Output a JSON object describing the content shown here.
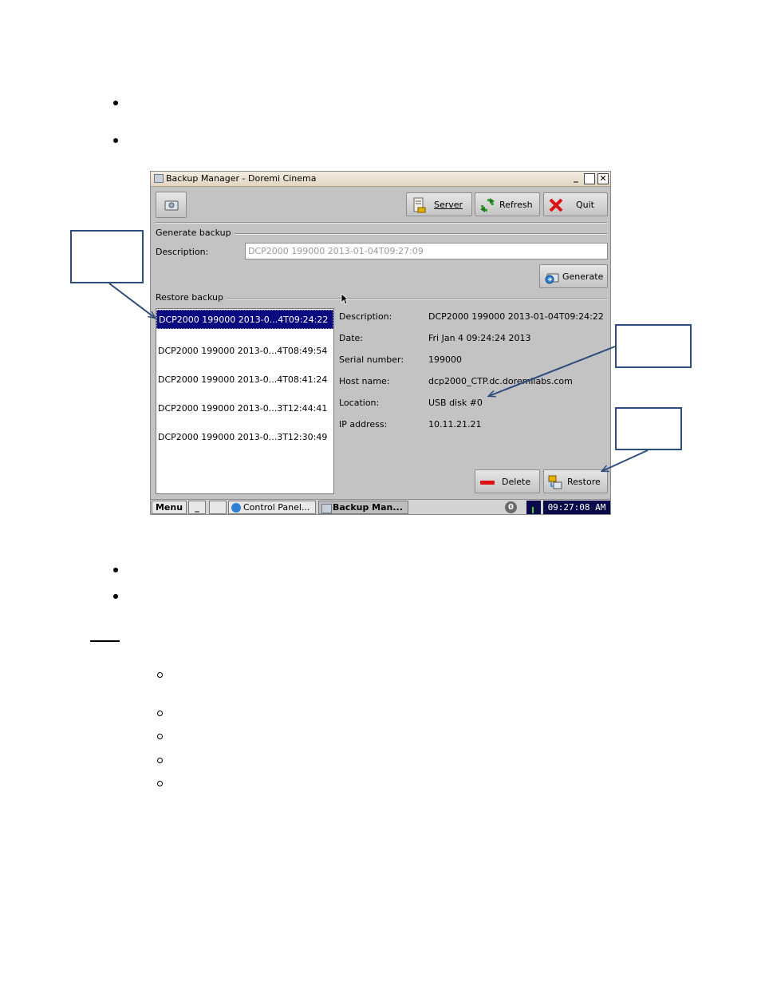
{
  "window": {
    "title": "Backup Manager - Doremi Cinema"
  },
  "toolbar": {
    "server_label": "Server",
    "refresh_label": "Refresh",
    "quit_label": "Quit"
  },
  "generate": {
    "section_title": "Generate backup",
    "description_label": "Description:",
    "description_value": "DCP2000 199000 2013-01-04T09:27:09",
    "generate_label": "Generate"
  },
  "restore": {
    "section_title": "Restore backup",
    "backups": [
      {
        "label": "DCP2000 199000 2013-0...4T09:24:22"
      },
      {
        "label": "DCP2000 199000 2013-0...4T08:49:54"
      },
      {
        "label": "DCP2000 199000 2013-0...4T08:41:24"
      },
      {
        "label": "DCP2000 199000 2013-0...3T12:44:41"
      },
      {
        "label": "DCP2000 199000 2013-0...3T12:30:49"
      }
    ],
    "selected_index": 0,
    "details": {
      "description_label": "Description:",
      "description_value": "DCP2000 199000 2013-01-04T09:24:22",
      "date_label": "Date:",
      "date_value": "Fri Jan 4 09:24:24 2013",
      "serial_label": "Serial number:",
      "serial_value": "199000",
      "host_label": "Host name:",
      "host_value": "dcp2000_CTP.dc.doremilabs.com",
      "location_label": "Location:",
      "location_value": "USB disk #0",
      "ip_label": "IP address:",
      "ip_value": "10.11.21.21"
    },
    "delete_label": "Delete",
    "restore_label": "Restore"
  },
  "taskbar": {
    "menu_label": "Menu",
    "minimize_label": "_",
    "control_panel_label": "Control Panel...",
    "backup_manager_label": "Backup Man...",
    "notification_count": "0",
    "clock": "09:27:08 AM"
  },
  "colors": {
    "window_bg": "#c3c3c3",
    "selection": "#0a0a80",
    "callout": "#2d4d7c"
  }
}
